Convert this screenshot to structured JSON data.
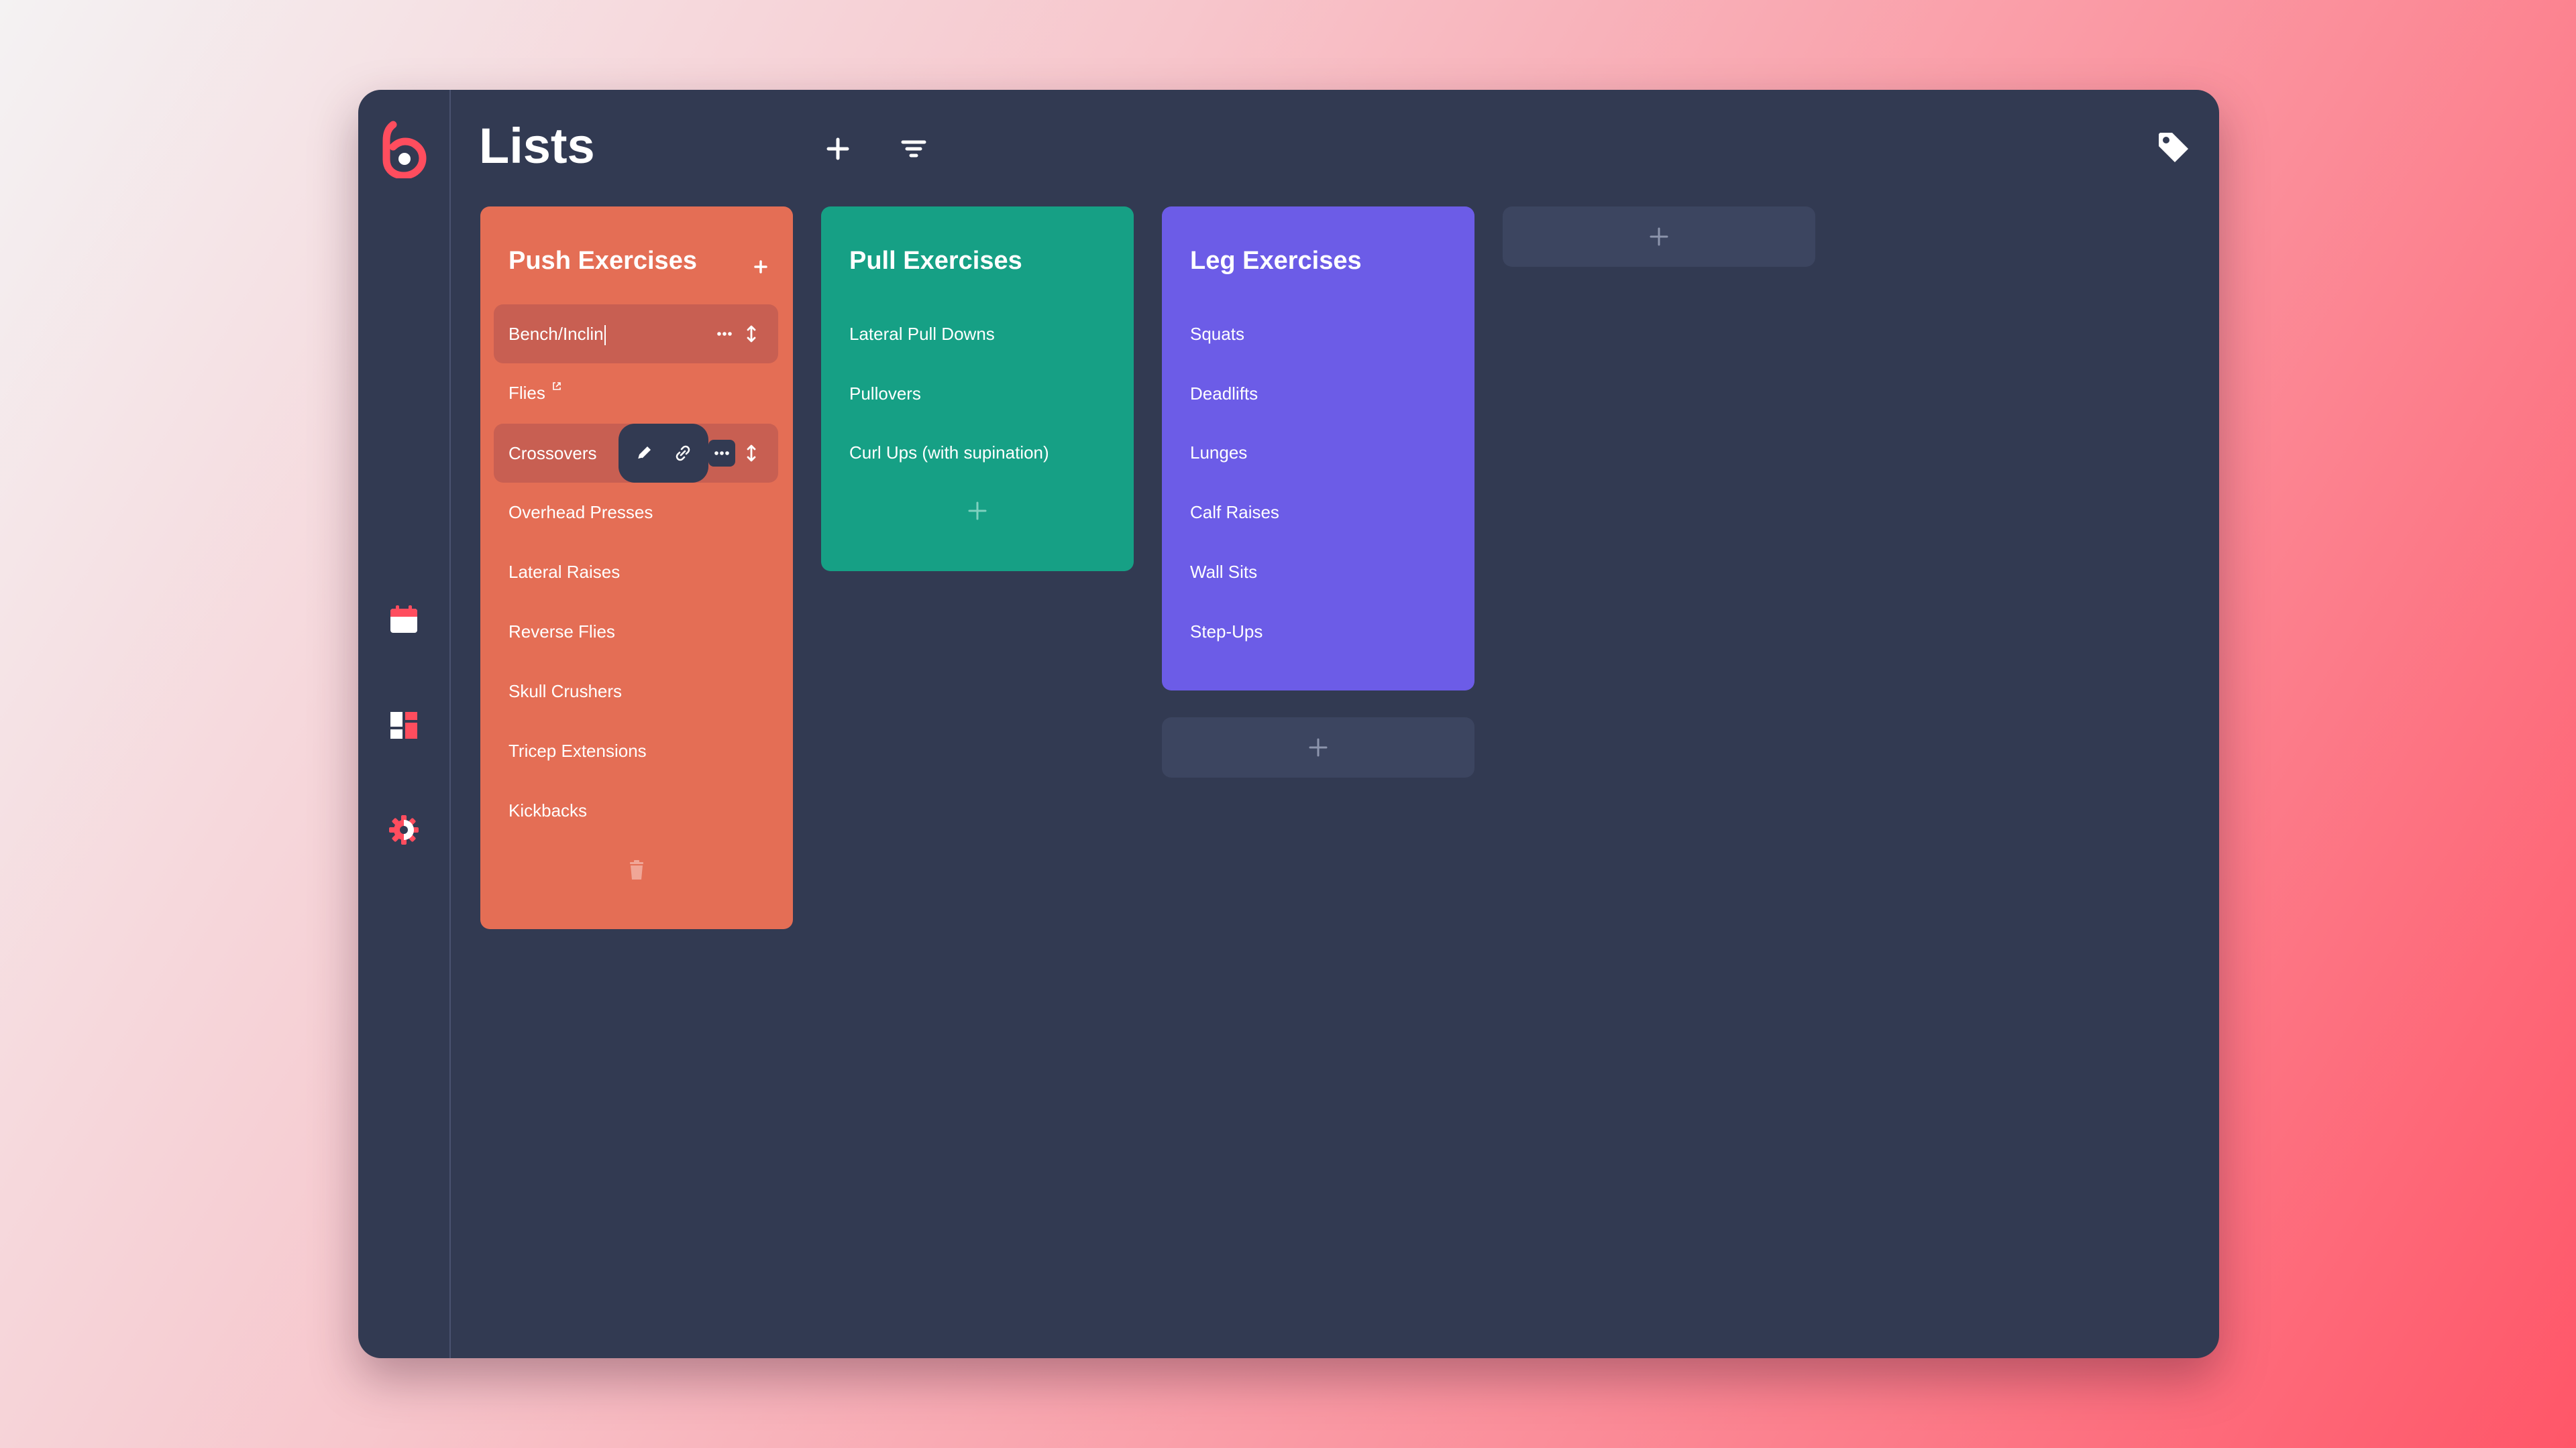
{
  "app": {
    "title": "Lists"
  },
  "sidebar": {
    "logo": "b-logo",
    "items": [
      {
        "icon": "calendar-icon"
      },
      {
        "icon": "dashboard-icon"
      },
      {
        "icon": "settings-gear-icon"
      }
    ]
  },
  "toolbar": {
    "add_icon": "plus-icon",
    "filter_icon": "filter-icon",
    "tag_icon": "tag-icon"
  },
  "columns": [
    {
      "title": "Push Exercises",
      "color": "#e46e55",
      "items": [
        {
          "label": "Bench/Inclin",
          "state": "editing"
        },
        {
          "label": "Flies",
          "has_link": true
        },
        {
          "label": "Crossovers",
          "state": "hover-actions"
        },
        {
          "label": "Overhead Presses"
        },
        {
          "label": "Lateral Raises"
        },
        {
          "label": "Reverse Flies"
        },
        {
          "label": "Skull Crushers"
        },
        {
          "label": "Tricep Extensions"
        },
        {
          "label": "Kickbacks"
        }
      ]
    },
    {
      "title": "Pull Exercises",
      "color": "#16a085",
      "items": [
        {
          "label": "Lateral Pull Downs"
        },
        {
          "label": "Pullovers"
        },
        {
          "label": "Curl Ups (with supination)"
        }
      ]
    },
    {
      "title": "Leg Exercises",
      "color": "#6c5ce7",
      "items": [
        {
          "label": "Squats"
        },
        {
          "label": "Deadlifts"
        },
        {
          "label": "Lunges"
        },
        {
          "label": "Calf Raises"
        },
        {
          "label": "Wall Sits"
        },
        {
          "label": "Step-Ups"
        }
      ]
    }
  ],
  "colors": {
    "panel": "#323a52",
    "accent": "#ff4d5e",
    "push": "#e46e55",
    "pull": "#16a085",
    "leg": "#6c5ce7"
  }
}
